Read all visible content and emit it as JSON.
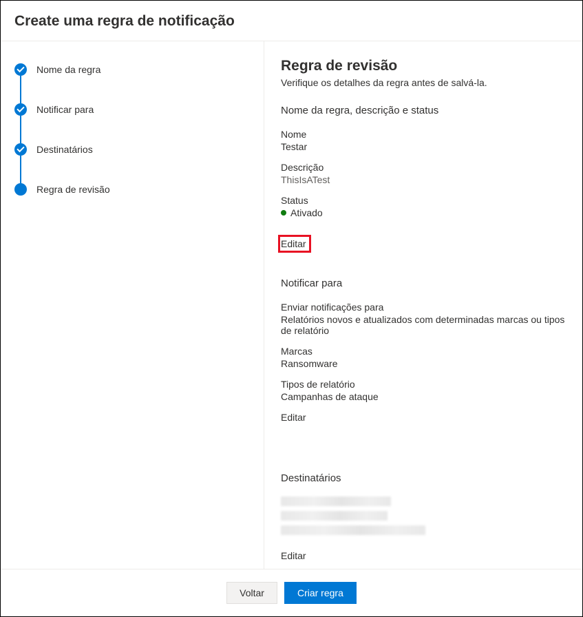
{
  "header": {
    "title": "Create uma regra de notificação"
  },
  "sidebar": {
    "steps": [
      {
        "label": "Nome da regra",
        "state": "completed"
      },
      {
        "label": "Notificar para",
        "state": "completed"
      },
      {
        "label": "Destinatários",
        "state": "completed"
      },
      {
        "label": "Regra de revisão",
        "state": "current"
      }
    ]
  },
  "main": {
    "title": "Regra de revisão",
    "subtitle": "Verifique os detalhes da regra antes de salvá-la.",
    "section1": {
      "title": "Nome da regra, descrição e status",
      "name_label": "Nome",
      "name_value": "Testar",
      "desc_label": "Descrição",
      "desc_value": "ThisIsATest",
      "status_label": "Status",
      "status_value": "Ativado",
      "status_color": "#107c10",
      "edit": "Editar"
    },
    "section2": {
      "title": "Notificar para",
      "send_label": "Enviar notificações para",
      "send_value": "Relatórios novos e atualizados com determinadas marcas ou tipos de relatório",
      "tags_label": "Marcas",
      "tags_value": "Ransomware",
      "types_label": "Tipos de relatório",
      "types_value": "Campanhas de ataque",
      "edit": "Editar"
    },
    "section3": {
      "title": "Destinatários",
      "edit": "Editar"
    }
  },
  "footer": {
    "back": "Voltar",
    "create": "Criar regra"
  },
  "colors": {
    "accent": "#0078d4",
    "highlight": "#e81123"
  }
}
